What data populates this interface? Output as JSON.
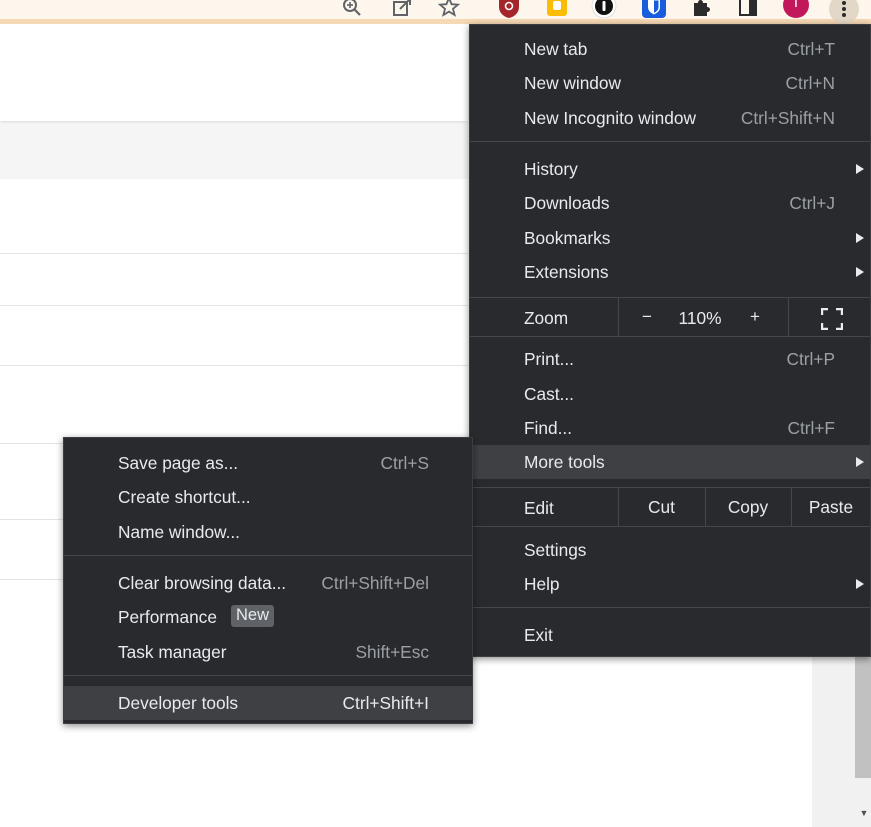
{
  "toolbar": {
    "icons": [
      "zoom-icon",
      "share-icon",
      "star-icon",
      "extension-red-icon",
      "extension-yellow-icon",
      "password-manager-icon",
      "bitwarden-icon",
      "puzzle-icon",
      "sidepanel-icon",
      "profile-avatar",
      "menu-dots-icon"
    ],
    "profile_initial": "T",
    "colors": {
      "strip": "#fdf6ec",
      "strip_border": "#f6d9b4",
      "red_ext": "#a4262c",
      "yellow_ext": "#fbbc04",
      "bitwarden": "#175ddc",
      "avatar": "#c2185b"
    }
  },
  "main_menu": {
    "new_tab": {
      "label": "New tab",
      "shortcut": "Ctrl+T"
    },
    "new_window": {
      "label": "New window",
      "shortcut": "Ctrl+N"
    },
    "new_incognito": {
      "label": "New Incognito window",
      "shortcut": "Ctrl+Shift+N"
    },
    "history": {
      "label": "History"
    },
    "downloads": {
      "label": "Downloads",
      "shortcut": "Ctrl+J"
    },
    "bookmarks": {
      "label": "Bookmarks"
    },
    "extensions": {
      "label": "Extensions"
    },
    "zoom": {
      "label": "Zoom",
      "minus": "−",
      "value": "110%",
      "plus": "+"
    },
    "print": {
      "label": "Print...",
      "shortcut": "Ctrl+P"
    },
    "cast": {
      "label": "Cast..."
    },
    "find": {
      "label": "Find...",
      "shortcut": "Ctrl+F"
    },
    "more_tools": {
      "label": "More tools"
    },
    "edit": {
      "label": "Edit",
      "cut": "Cut",
      "copy": "Copy",
      "paste": "Paste"
    },
    "settings": {
      "label": "Settings"
    },
    "help": {
      "label": "Help"
    },
    "exit": {
      "label": "Exit"
    }
  },
  "sub_menu": {
    "save_page": {
      "label": "Save page as...",
      "shortcut": "Ctrl+S"
    },
    "create_shortcut": {
      "label": "Create shortcut..."
    },
    "name_window": {
      "label": "Name window..."
    },
    "clear_browsing": {
      "label": "Clear browsing data...",
      "shortcut": "Ctrl+Shift+Del"
    },
    "performance": {
      "label": "Performance",
      "badge": "New"
    },
    "task_manager": {
      "label": "Task manager",
      "shortcut": "Shift+Esc"
    },
    "developer_tools": {
      "label": "Developer tools",
      "shortcut": "Ctrl+Shift+I"
    }
  },
  "theme": {
    "menu_bg": "#292a2d",
    "menu_text": "#e8eaed",
    "shortcut_text": "#9aa0a6",
    "highlight": "#3f4043"
  }
}
